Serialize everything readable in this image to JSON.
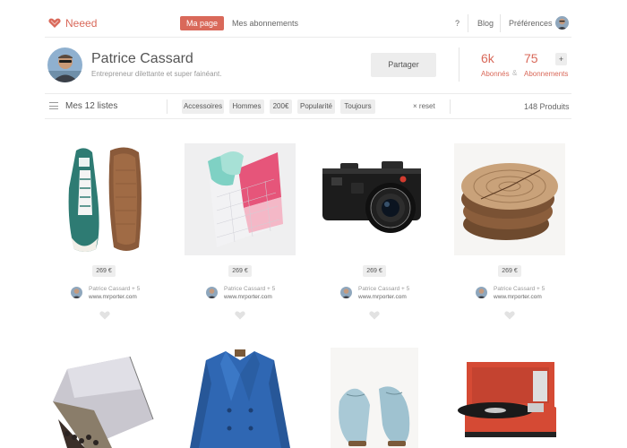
{
  "nav": {
    "logo": "Neeed",
    "items": [
      "Ma page",
      "Mes abonnements"
    ],
    "help": "?",
    "blog": "Blog",
    "prefs": "Préférences"
  },
  "profile": {
    "name": "Patrice Cassard",
    "bio": "Entrepreneur dilettante et super fainéant.",
    "share": "Partager",
    "followers": {
      "count": "6k",
      "label": "Abonnés"
    },
    "amp": "&",
    "following": {
      "count": "75",
      "label": "Abonnements"
    },
    "plus": "+"
  },
  "filters": {
    "title": "Mes 12 listes",
    "chips": [
      "Accessoires",
      "Hommes",
      "200€",
      "Popularité",
      "Toujours"
    ],
    "reset": "reset",
    "reset_icon": "×",
    "count": "148 Produits"
  },
  "products": [
    {
      "image": "sneakers",
      "price": "269 €",
      "user": "Patrice Cassard + 5",
      "site": "www.mrporter.com"
    },
    {
      "image": "bedding",
      "price": "269 €",
      "user": "Patrice Cassard + 5",
      "site": "www.mrporter.com"
    },
    {
      "image": "camera",
      "price": "269 €",
      "user": "Patrice Cassard + 5",
      "site": "www.mrporter.com"
    },
    {
      "image": "wood-slices",
      "price": "269 €",
      "user": "Patrice Cassard + 5",
      "site": "www.mrporter.com"
    },
    {
      "image": "scarf"
    },
    {
      "image": "blue-coat"
    },
    {
      "image": "blue-shoes"
    },
    {
      "image": "record-player"
    }
  ],
  "colors": {
    "accent": "#d9695a",
    "chip_bg": "#eeeeee"
  }
}
